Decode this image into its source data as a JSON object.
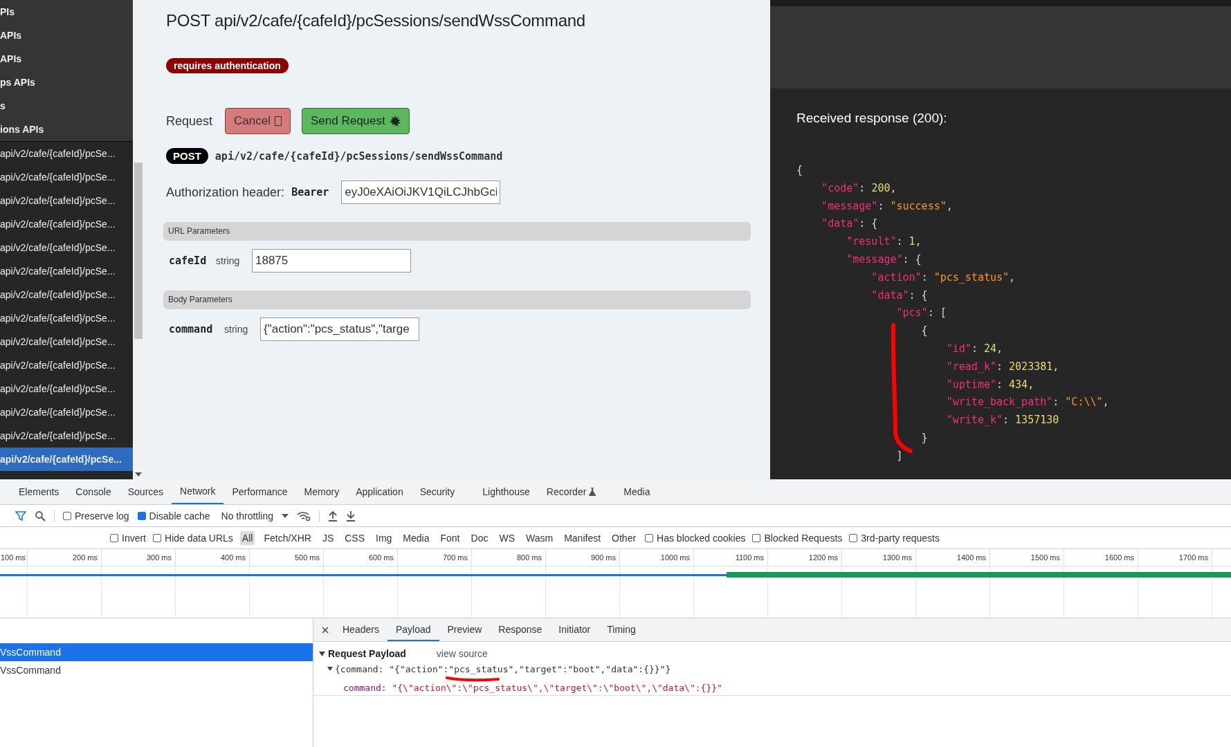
{
  "sidebar": {
    "categories": [
      "PIs",
      "APIs",
      "APIs",
      "ps APIs",
      "s",
      "ions APIs"
    ],
    "endpoints": [
      {
        "label": "api/v2/cafe/{cafeId}/pcSe...",
        "selected": false
      },
      {
        "label": "api/v2/cafe/{cafeId}/pcSe...",
        "selected": false
      },
      {
        "label": "api/v2/cafe/{cafeId}/pcSe...",
        "selected": false
      },
      {
        "label": "api/v2/cafe/{cafeId}/pcSe...",
        "selected": false
      },
      {
        "label": "api/v2/cafe/{cafeId}/pcSe...",
        "selected": false
      },
      {
        "label": "api/v2/cafe/{cafeId}/pcSe...",
        "selected": false
      },
      {
        "label": "api/v2/cafe/{cafeId}/pcSe...",
        "selected": false
      },
      {
        "label": "api/v2/cafe/{cafeId}/pcSe...",
        "selected": false
      },
      {
        "label": "api/v2/cafe/{cafeId}/pcSe...",
        "selected": false
      },
      {
        "label": "api/v2/cafe/{cafeId}/pcSe...",
        "selected": false
      },
      {
        "label": "api/v2/cafe/{cafeId}/pcSe...",
        "selected": false
      },
      {
        "label": "api/v2/cafe/{cafeId}/pcSe...",
        "selected": false
      },
      {
        "label": "api/v2/cafe/{cafeId}/pcSe...",
        "selected": false
      },
      {
        "label": "api/v2/cafe/{cafeId}/pcSe...",
        "selected": true
      }
    ]
  },
  "endpoint": {
    "title": "POST api/v2/cafe/{cafeId}/pcSessions/sendWssCommand",
    "badge": "requires authentication",
    "request_label": "Request",
    "cancel_button": "Cancel",
    "send_button": "Send Request",
    "method": "POST",
    "path": "api/v2/cafe/{cafeId}/pcSessions/sendWssCommand",
    "auth_label": "Authorization header:",
    "auth_scheme": "Bearer",
    "auth_value": "eyJ0eXAiOiJKV1QiLCJhbGci",
    "sections": [
      {
        "title": "URL Parameters",
        "params": [
          {
            "name": "cafeId",
            "type": "string",
            "value": "18875"
          }
        ]
      },
      {
        "title": "Body Parameters",
        "params": [
          {
            "name": "command",
            "type": "string",
            "value": "{\"action\":\"pcs_status\",\"targe"
          }
        ]
      }
    ]
  },
  "response": {
    "heading": "Received response (200):",
    "lines": [
      [
        {
          "kind": "punct",
          "text": "{"
        }
      ],
      [
        {
          "kind": "key",
          "text": "    \"code\""
        },
        {
          "kind": "punct",
          "text": ": "
        },
        {
          "kind": "num",
          "text": "200"
        },
        {
          "kind": "punct",
          "text": ","
        }
      ],
      [
        {
          "kind": "key",
          "text": "    \"message\""
        },
        {
          "kind": "punct",
          "text": ": "
        },
        {
          "kind": "str",
          "text": "\"success\""
        },
        {
          "kind": "punct",
          "text": ","
        }
      ],
      [
        {
          "kind": "key",
          "text": "    \"data\""
        },
        {
          "kind": "punct",
          "text": ": {"
        }
      ],
      [
        {
          "kind": "key",
          "text": "        \"result\""
        },
        {
          "kind": "punct",
          "text": ": "
        },
        {
          "kind": "num",
          "text": "1"
        },
        {
          "kind": "punct",
          "text": ","
        }
      ],
      [
        {
          "kind": "key",
          "text": "        \"message\""
        },
        {
          "kind": "punct",
          "text": ": {"
        }
      ],
      [
        {
          "kind": "key",
          "text": "            \"action\""
        },
        {
          "kind": "punct",
          "text": ": "
        },
        {
          "kind": "str",
          "text": "\"pcs_status\""
        },
        {
          "kind": "punct",
          "text": ","
        }
      ],
      [
        {
          "kind": "key",
          "text": "            \"data\""
        },
        {
          "kind": "punct",
          "text": ": {"
        }
      ],
      [
        {
          "kind": "key",
          "text": "                \"pcs\""
        },
        {
          "kind": "punct",
          "text": ": ["
        }
      ],
      [
        {
          "kind": "punct",
          "text": "                    {"
        }
      ],
      [
        {
          "kind": "key",
          "text": "                        \"id\""
        },
        {
          "kind": "punct",
          "text": ": "
        },
        {
          "kind": "num",
          "text": "24"
        },
        {
          "kind": "punct",
          "text": ","
        }
      ],
      [
        {
          "kind": "key",
          "text": "                        \"read_k\""
        },
        {
          "kind": "punct",
          "text": ": "
        },
        {
          "kind": "num",
          "text": "2023381"
        },
        {
          "kind": "punct",
          "text": ","
        }
      ],
      [
        {
          "kind": "key",
          "text": "                        \"uptime\""
        },
        {
          "kind": "punct",
          "text": ": "
        },
        {
          "kind": "num",
          "text": "434"
        },
        {
          "kind": "punct",
          "text": ","
        }
      ],
      [
        {
          "kind": "key",
          "text": "                        \"write_back_path\""
        },
        {
          "kind": "punct",
          "text": ": "
        },
        {
          "kind": "str",
          "text": "\"C:\\\\\""
        },
        {
          "kind": "punct",
          "text": ","
        }
      ],
      [
        {
          "kind": "key",
          "text": "                        \"write_k\""
        },
        {
          "kind": "punct",
          "text": ": "
        },
        {
          "kind": "num",
          "text": "1357130"
        }
      ],
      [
        {
          "kind": "punct",
          "text": "                    }"
        }
      ],
      [
        {
          "kind": "punct",
          "text": "                ]"
        }
      ]
    ]
  },
  "devtools": {
    "tabs": [
      {
        "label": "Elements",
        "selected": false
      },
      {
        "label": "Console",
        "selected": false
      },
      {
        "label": "Sources",
        "selected": false
      },
      {
        "label": "Network",
        "selected": true
      },
      {
        "label": "Performance",
        "selected": false
      },
      {
        "label": "Memory",
        "selected": false
      },
      {
        "label": "Application",
        "selected": false
      },
      {
        "label": "Security",
        "selected": false
      },
      {
        "label": "Lighthouse",
        "selected": false
      },
      {
        "label": "Recorder",
        "selected": false
      },
      {
        "label": "Media",
        "selected": false
      }
    ],
    "toolbar": {
      "preserve_log": {
        "label": "Preserve log",
        "checked": false
      },
      "disable_cache": {
        "label": "Disable cache",
        "checked": true
      },
      "throttling": "No throttling"
    },
    "filter_bar": {
      "invert": {
        "label": "Invert",
        "checked": false
      },
      "hide_data_urls": {
        "label": "Hide data URLs",
        "checked": false
      },
      "types": [
        {
          "label": "All",
          "selected": true
        },
        {
          "label": "Fetch/XHR",
          "selected": false
        },
        {
          "label": "JS",
          "selected": false
        },
        {
          "label": "CSS",
          "selected": false
        },
        {
          "label": "Img",
          "selected": false
        },
        {
          "label": "Media",
          "selected": false
        },
        {
          "label": "Font",
          "selected": false
        },
        {
          "label": "Doc",
          "selected": false
        },
        {
          "label": "WS",
          "selected": false
        },
        {
          "label": "Wasm",
          "selected": false
        },
        {
          "label": "Manifest",
          "selected": false
        },
        {
          "label": "Other",
          "selected": false
        }
      ],
      "options": [
        {
          "label": "Has blocked cookies",
          "checked": false
        },
        {
          "label": "Blocked Requests",
          "checked": false
        },
        {
          "label": "3rd-party requests",
          "checked": false
        }
      ]
    },
    "timeline_ticks": [
      "100 ms",
      "200 ms",
      "300 ms",
      "400 ms",
      "500 ms",
      "600 ms",
      "700 ms",
      "800 ms",
      "900 ms",
      "1000 ms",
      "1100 ms",
      "1200 ms",
      "1300 ms",
      "1400 ms",
      "1500 ms",
      "1600 ms",
      "1700 ms"
    ],
    "requests": [
      {
        "name": "VssCommand",
        "selected": true
      },
      {
        "name": "VssCommand",
        "selected": false
      }
    ],
    "detail_tabs": [
      {
        "label": "Headers",
        "selected": false
      },
      {
        "label": "Payload",
        "selected": true
      },
      {
        "label": "Preview",
        "selected": false
      },
      {
        "label": "Response",
        "selected": false
      },
      {
        "label": "Initiator",
        "selected": false
      },
      {
        "label": "Timing",
        "selected": false
      }
    ],
    "payload": {
      "title": "Request Payload",
      "view_source": "view source",
      "summary": "{command: \"{\"action\":\"pcs_status\",\"target\":\"boot\",\"data\":{}}\"}",
      "key": "command:",
      "value": "\"{\\\"action\\\":\\\"pcs_status\\\",\\\"target\\\":\\\"boot\\\",\\\"data\\\":{}}\""
    }
  }
}
